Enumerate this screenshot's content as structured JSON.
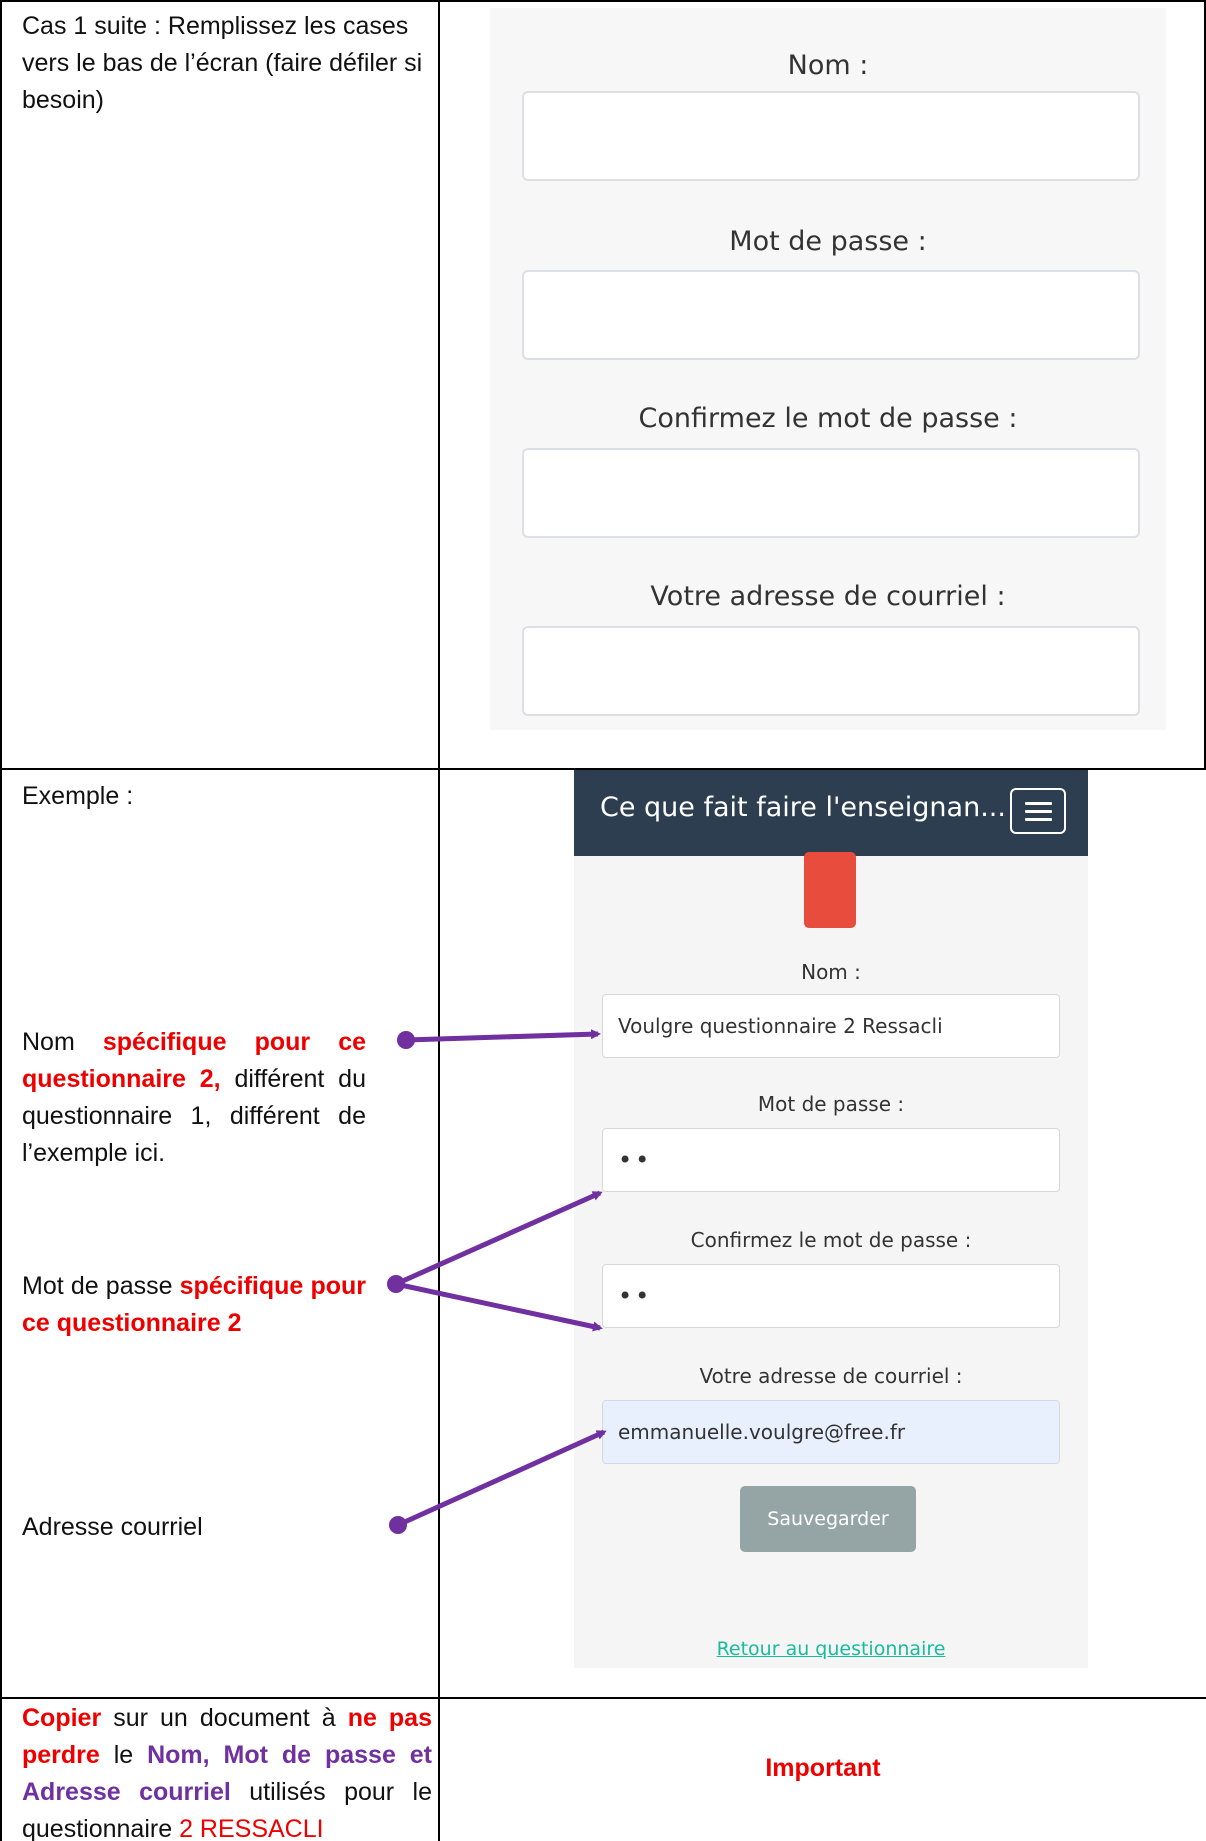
{
  "row1": {
    "instruction": "Cas 1 suite : Remplissez les cases vers le bas de l’écran (faire défiler si besoin)",
    "form": {
      "nom_label": "Nom :",
      "password_label": "Mot de passe :",
      "confirm_label": "Confirmez le mot de passe :",
      "email_label": "Votre adresse de courriel :"
    }
  },
  "row2": {
    "example_label": "Exemple :",
    "annotation_nom": {
      "part1": "Nom ",
      "part2": "spécifique pour ce questionnaire 2,",
      "part3": " différent du questionnaire 1, différent de l’exemple ici."
    },
    "annotation_password": {
      "part1": "Mot de passe ",
      "part2": "spécifique pour ce questionnaire 2"
    },
    "annotation_email": "Adresse courriel",
    "app": {
      "title": "Ce que fait faire l'enseignan...",
      "nom_label": "Nom :",
      "nom_value": "Voulgre questionnaire 2 Ressacli",
      "password_label": "Mot de passe :",
      "password_value": "••",
      "confirm_label": "Confirmez le mot de passe :",
      "confirm_value": "••",
      "email_label": "Votre adresse de courriel :",
      "email_value": "emmanuelle.voulgre@free.fr",
      "save_button": "Sauvegarder",
      "back_link": "Retour au questionnaire"
    },
    "colors": {
      "header_bg": "#2c3e50",
      "logo": "#e74c3c",
      "button": "#95a5a6",
      "link": "#18bc9c",
      "arrow": "#7030a0"
    }
  },
  "row3": {
    "copy_word": "Copier",
    "text1": " sur un document à ",
    "ne_pas_perdre": "ne pas perdre",
    "text2": " le ",
    "credentials": "Nom, Mot de passe et Adresse courriel",
    "text3": " utilisés pour le questionnaire ",
    "ressacli": "2 RESSACLI",
    "important": "Important"
  },
  "colors": {
    "emphasis_red": "#ee0000",
    "emphasis_purple": "#7030a0"
  }
}
